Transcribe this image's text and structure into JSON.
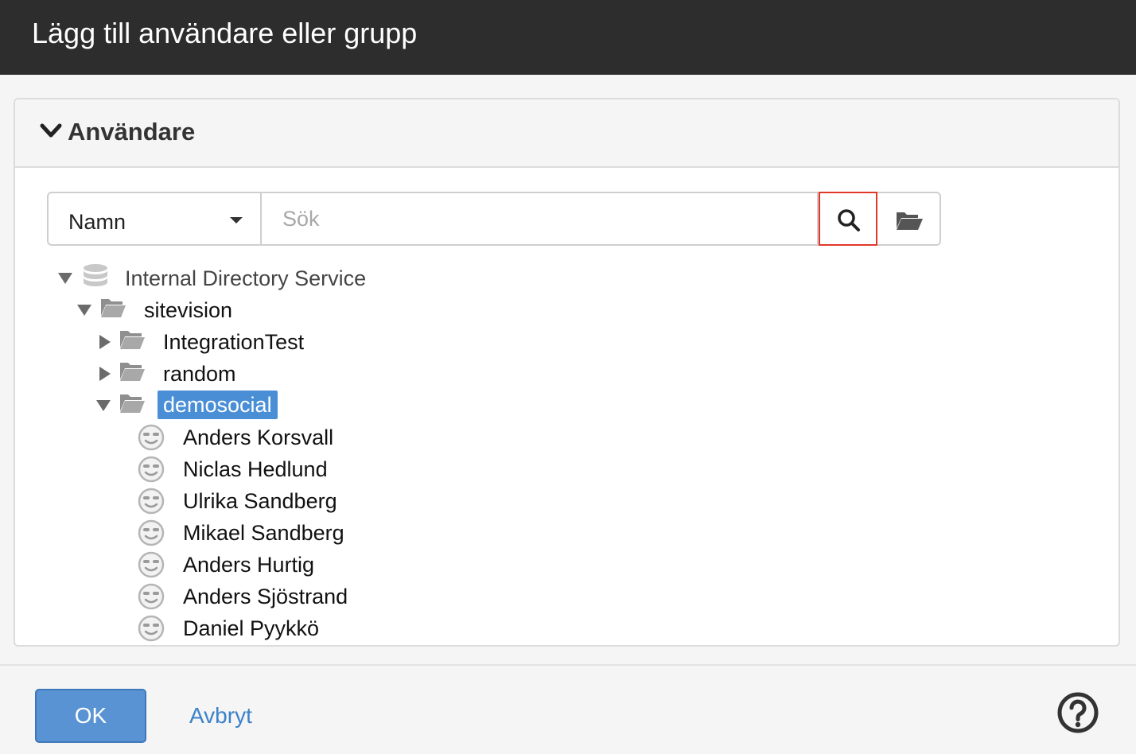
{
  "dialog": {
    "title": "Lägg till användare eller grupp"
  },
  "section": {
    "label": "Användare"
  },
  "search": {
    "field_select_value": "Namn",
    "placeholder": "Sök"
  },
  "tree": {
    "root": {
      "label": "Internal Directory Service",
      "icon": "database-icon",
      "expanded": true
    },
    "folder": {
      "label": "sitevision",
      "icon": "folder-open-icon",
      "expanded": true
    },
    "children": [
      {
        "label": "IntegrationTest",
        "icon": "folder-open-icon",
        "expanded": false
      },
      {
        "label": "random",
        "icon": "folder-open-icon",
        "expanded": false
      },
      {
        "label": "demosocial",
        "icon": "folder-open-icon",
        "expanded": true,
        "selected": true
      }
    ],
    "users": [
      "Anders Korsvall",
      "Niclas Hedlund",
      "Ulrika Sandberg",
      "Mikael Sandberg",
      "Anders Hurtig",
      "Anders Sjöstrand",
      "Daniel Pyykkö"
    ]
  },
  "footer": {
    "ok_label": "OK",
    "cancel_label": "Avbryt"
  },
  "colors": {
    "titlebar": "#2d2d2d",
    "selection": "#4a8fd6",
    "primary_button": "#5a93d3",
    "link": "#3c82c9",
    "highlight_border": "#e2372a"
  }
}
